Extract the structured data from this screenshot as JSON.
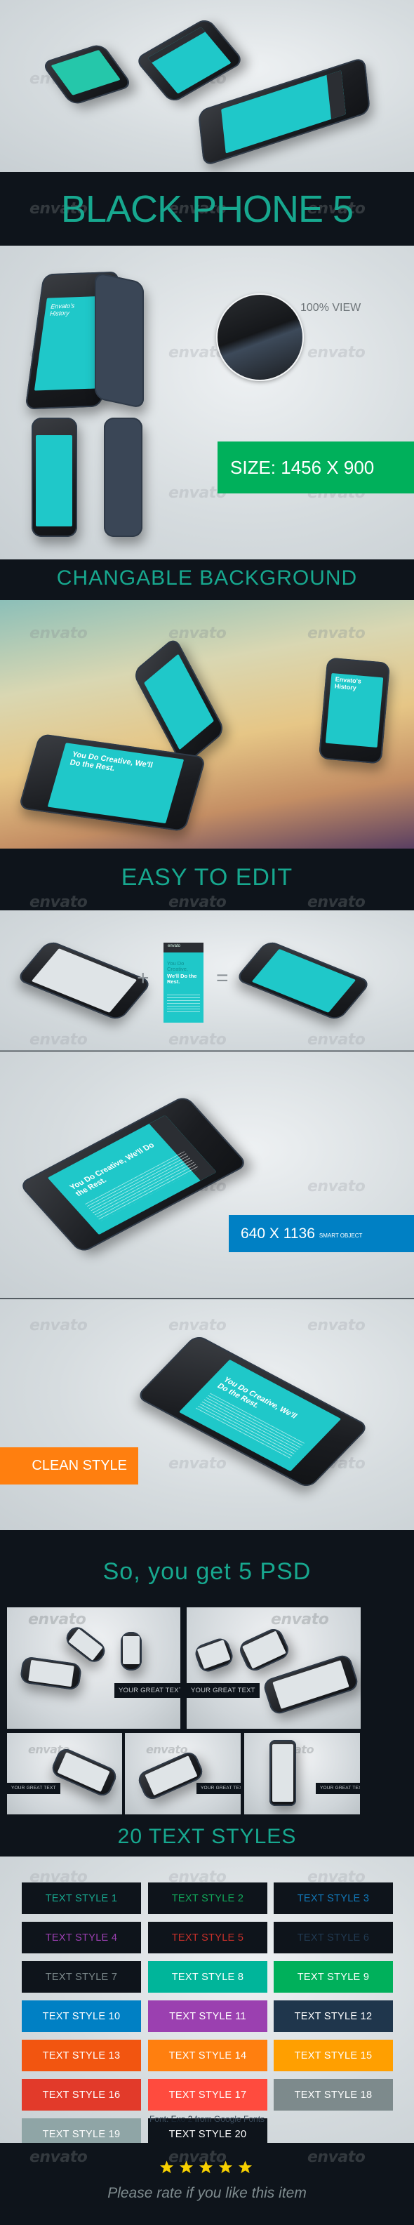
{
  "watermark": "envato",
  "sections": {
    "title_band": {
      "title": "BLACK PHONE 5"
    },
    "zoom_view": {
      "label": "100% VIEW"
    },
    "size_banner": {
      "label": "SIZE: 1456 X 900",
      "color": "#00b05b"
    },
    "background_band": {
      "title": "CHANGABLE BACKGROUND"
    },
    "edit_band": {
      "title": "EASY TO EDIT"
    },
    "edit_demo": {
      "plus": "+",
      "equals": "=",
      "screen_brand": "envato",
      "screen_headline_1": "You Do Creative,",
      "screen_headline_2": "We'll Do the Rest."
    },
    "smart_banner": {
      "dimensions": "640 X 1136",
      "note": "SMART OBJECT",
      "color": "#0080c4"
    },
    "clean_banner": {
      "label": "CLEAN STYLE",
      "color": "#ff7f0f"
    },
    "psd_band": {
      "title": "So, you get 5 PSD",
      "thumbnails": [
        {
          "label": "YOUR GREAT TEXT"
        },
        {
          "label": "YOUR GREAT TEXT"
        },
        {
          "label": "YOUR GREAT TEXT"
        },
        {
          "label": "YOUR GREAT TEXT"
        },
        {
          "label": "YOUR GREAT TEXT"
        }
      ]
    },
    "styles_band": {
      "title": "20 TEXT STYLES"
    },
    "text_styles": [
      {
        "label": "TEXT STYLE 1",
        "bg": "#0e141b",
        "fg": "#17a88f"
      },
      {
        "label": "TEXT STYLE 2",
        "bg": "#0e141b",
        "fg": "#10a95a"
      },
      {
        "label": "TEXT STYLE 3",
        "bg": "#0e141b",
        "fg": "#1178b8"
      },
      {
        "label": "TEXT STYLE 4",
        "bg": "#0e141b",
        "fg": "#9b3fb0"
      },
      {
        "label": "TEXT STYLE 5",
        "bg": "#0e141b",
        "fg": "#c9302a"
      },
      {
        "label": "TEXT STYLE 6",
        "bg": "#0e141b",
        "fg": "#213a52"
      },
      {
        "label": "TEXT STYLE 7",
        "bg": "#0e141b",
        "fg": "#7d8a8c"
      },
      {
        "label": "TEXT STYLE 8",
        "bg": "#00b59a",
        "fg": "#ffffff"
      },
      {
        "label": "TEXT STYLE 9",
        "bg": "#00b05b",
        "fg": "#ffffff"
      },
      {
        "label": "TEXT STYLE 10",
        "bg": "#0080c4",
        "fg": "#ffffff"
      },
      {
        "label": "TEXT STYLE 11",
        "bg": "#9b40b0",
        "fg": "#ffffff"
      },
      {
        "label": "TEXT STYLE 12",
        "bg": "#1f364c",
        "fg": "#ffffff"
      },
      {
        "label": "TEXT STYLE 13",
        "bg": "#f25510",
        "fg": "#ffffff"
      },
      {
        "label": "TEXT STYLE 14",
        "bg": "#ff7f0f",
        "fg": "#ffffff"
      },
      {
        "label": "TEXT STYLE 15",
        "bg": "#ff9f00",
        "fg": "#ffffff"
      },
      {
        "label": "TEXT STYLE 16",
        "bg": "#e23a2a",
        "fg": "#ffffff"
      },
      {
        "label": "TEXT STYLE 17",
        "bg": "#ff4b3e",
        "fg": "#ffffff"
      },
      {
        "label": "TEXT STYLE 18",
        "bg": "#7d8a8c",
        "fg": "#ffffff"
      },
      {
        "label": "TEXT STYLE 19",
        "bg": "#8fa5a6",
        "fg": "#ffffff"
      },
      {
        "label": "TEXT STYLE 20",
        "bg": "#0e141b",
        "fg": "#ffffff"
      }
    ],
    "font_note": {
      "prefix": "Font: ",
      "font_name": "Exo 2",
      "suffix": " from Google Fonts"
    },
    "rating": {
      "stars": 5,
      "max_stars": 5,
      "star_color": "#f7d000",
      "message": "Please rate if you like this item"
    }
  },
  "colors": {
    "accent_teal": "#17a88f",
    "dark_bg": "#0e141b",
    "phone_screen": "#1fc8c9"
  }
}
